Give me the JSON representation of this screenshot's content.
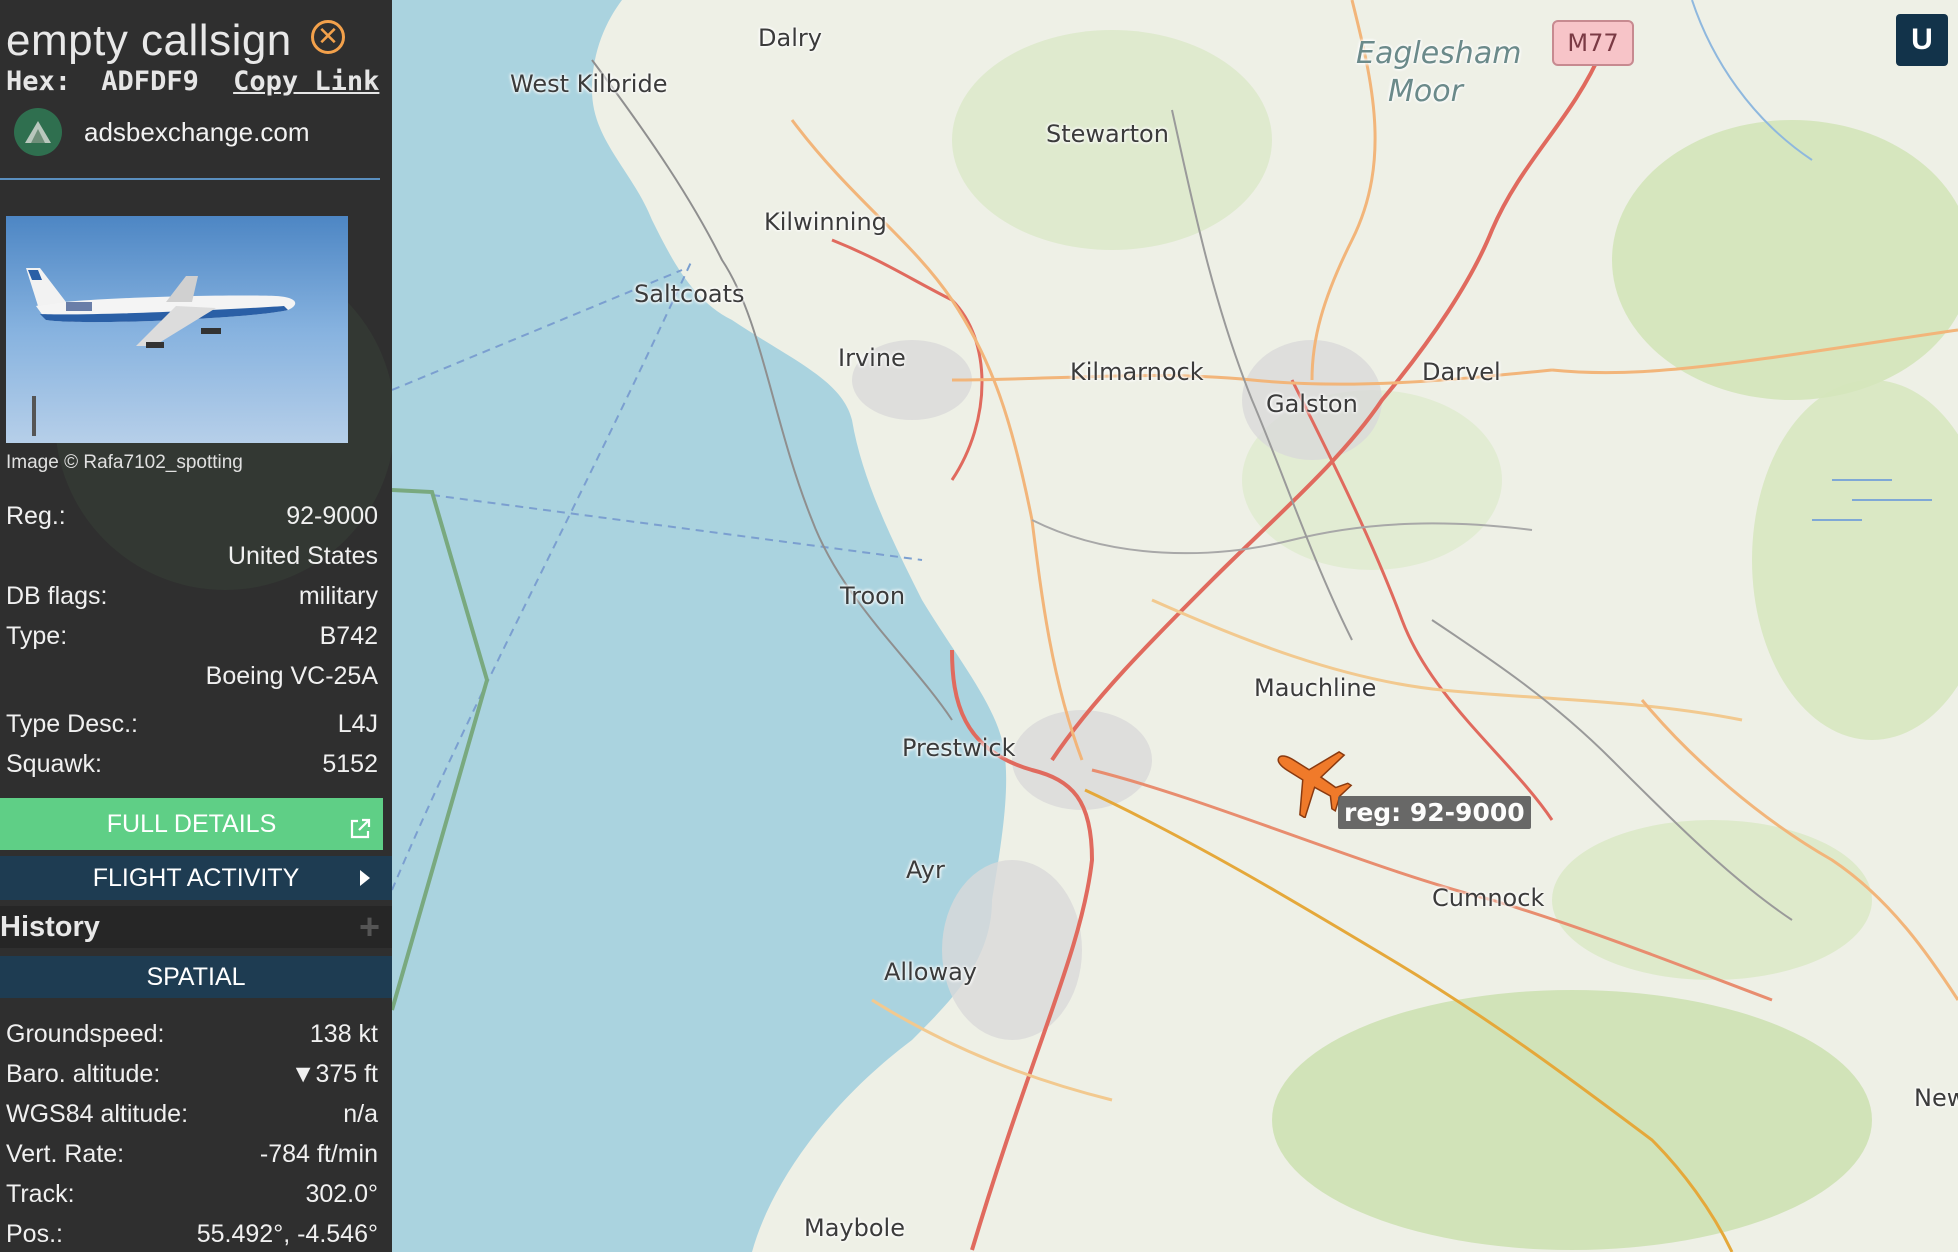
{
  "header": {
    "callsign": "empty callsign",
    "hex_label": "Hex:",
    "hex_value": "ADFDF9",
    "copy_link": "Copy Link",
    "source": "adsbexchange.com"
  },
  "photo": {
    "credit": "Image © Rafa7102_spotting"
  },
  "details": [
    {
      "key": "Reg.:",
      "value": "92-9000"
    },
    {
      "key": "",
      "value": "United States"
    },
    {
      "key": "DB flags:",
      "value": "military"
    },
    {
      "key": "Type:",
      "value": "B742"
    },
    {
      "key": "",
      "value": "Boeing VC-25A"
    },
    {
      "key": "Type Desc.:",
      "value": "L4J"
    },
    {
      "key": "Squawk:",
      "value": "5152"
    }
  ],
  "buttons": {
    "full_details": "FULL DETAILS",
    "flight_activity": "FLIGHT ACTIVITY",
    "history": "History",
    "spatial": "SPATIAL"
  },
  "spatial": [
    {
      "key": "Groundspeed:",
      "value": "138 kt"
    },
    {
      "key": "Baro. altitude:",
      "value": "▼375 ft"
    },
    {
      "key": "WGS84 altitude:",
      "value": "n/a"
    },
    {
      "key": "Vert. Rate:",
      "value": "-784 ft/min"
    },
    {
      "key": "Track:",
      "value": "302.0°"
    },
    {
      "key": "Pos.:",
      "value": "55.492°, -4.546°"
    }
  ],
  "map": {
    "places": [
      "Dalry",
      "West Kilbride",
      "Stewarton",
      "Eaglesham",
      "Moor",
      "Kilwinning",
      "Saltcoats",
      "Irvine",
      "Kilmarnock",
      "Galston",
      "Darvel",
      "Troon",
      "Mauchline",
      "Prestwick",
      "Ayr",
      "Alloway",
      "Cumnock",
      "Maybole",
      "New"
    ],
    "road_shield": "M77",
    "aircraft_label": "reg: 92-9000",
    "user_button": "U"
  },
  "colors": {
    "sidebar_bg": "#2f2f2f",
    "accent_orange": "#f3a14b",
    "full_details_green": "#5fcf86",
    "nav_blue": "#1e3c52",
    "aircraft": "#f07a2a",
    "track": "#e5a83a",
    "water": "#aad3df",
    "land": "#eef0e6"
  }
}
